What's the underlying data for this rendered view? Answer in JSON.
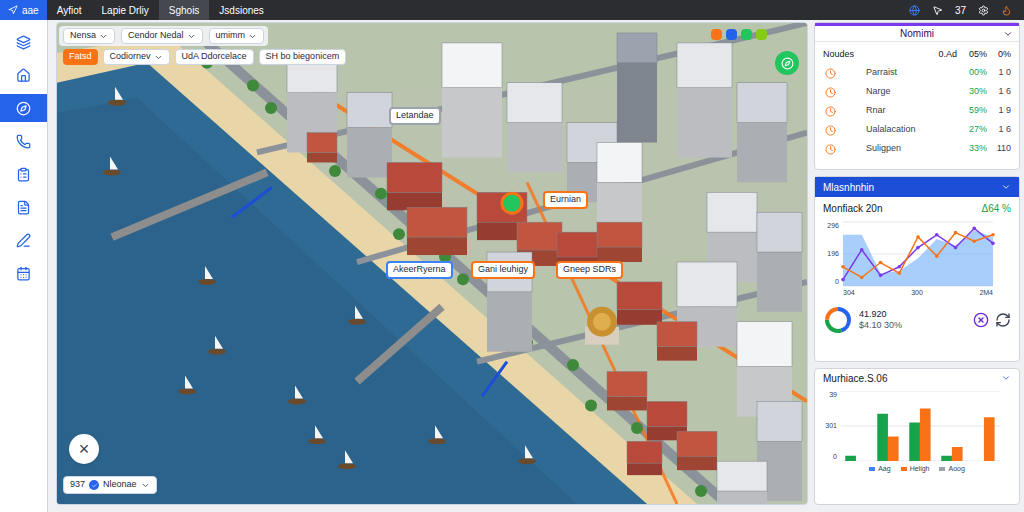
{
  "topbar": {
    "logo": "aae",
    "tabs": [
      {
        "label": "Ayfiot",
        "selected": false
      },
      {
        "label": "Lapie Drliy",
        "selected": false
      },
      {
        "label": "Sghois",
        "selected": true
      },
      {
        "label": "Jsdsiones",
        "selected": false
      }
    ],
    "badge": "37"
  },
  "sidebar": {
    "items": [
      {
        "selected": false
      },
      {
        "selected": false
      },
      {
        "selected": true
      },
      {
        "selected": false
      },
      {
        "selected": false
      },
      {
        "selected": false
      },
      {
        "selected": false
      },
      {
        "selected": false
      }
    ]
  },
  "map": {
    "filters": [
      {
        "label": "Nensa",
        "kind": "dropdown"
      },
      {
        "label": "Cendor Nedal",
        "kind": "dropdown"
      },
      {
        "label": "umimm",
        "kind": "dropdown"
      }
    ],
    "chips": [
      {
        "label": "Fatsd",
        "kind": "tag",
        "selected": true
      },
      {
        "label": "Codiornev",
        "kind": "dropdown",
        "selected": false
      },
      {
        "label": "UdA Ddorcelace",
        "kind": "chip",
        "selected": false
      },
      {
        "label": "SH bo biegonicem",
        "kind": "chip",
        "selected": false
      }
    ],
    "labels": [
      {
        "text": "Letandae",
        "color": "#9ca3af"
      },
      {
        "text": "Eurnian",
        "color": "#f97316"
      },
      {
        "text": "AkeerRyerna",
        "color": "#3b82f6"
      },
      {
        "text": "Gani leuhigy",
        "color": "#f97316"
      },
      {
        "text": "Gneep SDRs",
        "color": "#f97316"
      }
    ],
    "close": "×",
    "zoom": {
      "value": "937",
      "checked": true,
      "label": "Nleonae"
    }
  },
  "stats": {
    "title": "Nomimi",
    "header": [
      "Noudes",
      "0.Ad",
      "05%",
      "0%"
    ],
    "rows": [
      {
        "name": "Parraist",
        "pct": "00%",
        "count": "1 0"
      },
      {
        "name": "Narge",
        "pct": "30%",
        "count": "1 6"
      },
      {
        "name": "Rnar",
        "pct": "59%",
        "count": "1 9"
      },
      {
        "name": "Ualalacation",
        "pct": "27%",
        "count": "1 6"
      },
      {
        "name": "Suligpen",
        "pct": "33%",
        "count": "110"
      }
    ]
  },
  "trend": {
    "title": "Mlasnhnhin",
    "subtitle": "Monfiack 20n",
    "change": "Δ64 %",
    "y_ticks": [
      "296",
      "196",
      "0"
    ],
    "x_ticks": [
      "304",
      "300",
      "2M4"
    ],
    "max": 300,
    "series": [
      {
        "kind": "area",
        "color": "#60a5fa",
        "values": [
          240,
          240,
          60,
          70,
          130,
          220,
          190,
          260,
          230
        ]
      },
      {
        "kind": "line",
        "color": "#7c3aed",
        "values": [
          30,
          170,
          50,
          90,
          180,
          240,
          180,
          270,
          200
        ]
      },
      {
        "kind": "line",
        "color": "#f97316",
        "values": [
          90,
          40,
          110,
          60,
          230,
          140,
          250,
          210,
          240
        ]
      }
    ],
    "donut": {
      "value": "41.920",
      "caption": "$4.10 30%",
      "segments": [
        {
          "value": 45,
          "color": "#2563eb"
        },
        {
          "value": 30,
          "color": "#16a34a"
        },
        {
          "value": 25,
          "color": "#f97316"
        }
      ]
    }
  },
  "bars": {
    "title": "Murhiace.S.06",
    "y_ticks": [
      "39",
      "301",
      "0"
    ],
    "max": 40,
    "series": [
      {
        "color": "#16a34a",
        "values": [
          3,
          27,
          22,
          3,
          0
        ]
      },
      {
        "color": "#f97316",
        "values": [
          0,
          14,
          30,
          8,
          25
        ]
      }
    ],
    "legend": [
      {
        "label": "Aag",
        "color": "#3b82f6"
      },
      {
        "label": "Heligh",
        "color": "#f97316"
      },
      {
        "label": "Aoog",
        "color": "#9ca3af"
      }
    ]
  }
}
